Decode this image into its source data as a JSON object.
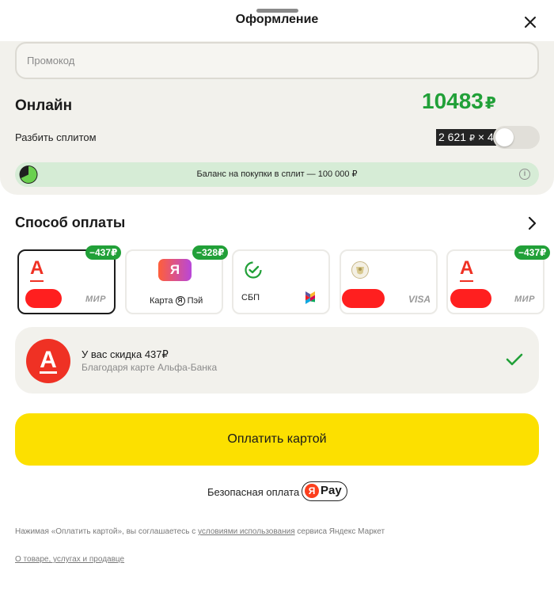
{
  "header": {
    "title": "Оформление",
    "close_icon": "close-icon"
  },
  "promo": {
    "placeholder": "Промокод",
    "value": ""
  },
  "summary": {
    "label": "Онлайн",
    "total": "10483",
    "currency": "₽",
    "split_label": "Разбить сплитом",
    "split_amount": "2 621",
    "split_currency": "₽",
    "split_times": "× 4",
    "split_enabled": false
  },
  "balance": {
    "text": "Баланс на покупки в сплит — 100 000 ₽",
    "info_icon": "i"
  },
  "payment": {
    "title": "Способ оплаты",
    "cards": [
      {
        "type": "alfa-mir",
        "logo": "А",
        "network": "МИР",
        "badge": "−437₽",
        "selected": true
      },
      {
        "type": "yandex-pay",
        "logo": "Я",
        "caption_pre": "Карта",
        "caption_ya": "Я",
        "caption_post": "Пэй",
        "badge": "−328₽",
        "selected": false
      },
      {
        "type": "sbp",
        "caption": "СБП",
        "selected": false
      },
      {
        "type": "tinkoff-visa",
        "network": "VISA",
        "selected": false
      },
      {
        "type": "alfa-mir",
        "logo": "А",
        "network": "МИР",
        "badge": "−437₽",
        "selected": false
      }
    ]
  },
  "discount": {
    "logo": "А",
    "title": "У вас скидка 437₽",
    "subtitle": "Благодаря карте Альфа-Банка"
  },
  "pay_button": {
    "label": "Оплатить картой"
  },
  "secure": {
    "text": "Безопасная оплата с",
    "badge_logo": "Я",
    "badge_text": "Pay"
  },
  "terms": {
    "pre": "Нажимая «Оплатить картой», вы соглашаетесь с ",
    "link": "условиями использования",
    "post": " сервиса Яндекс Маркет"
  },
  "about_link": "О товаре, услугах и продавце",
  "colors": {
    "accent_green": "#21a038",
    "button_yellow": "#fce000",
    "alfa_red": "#ef3124"
  }
}
